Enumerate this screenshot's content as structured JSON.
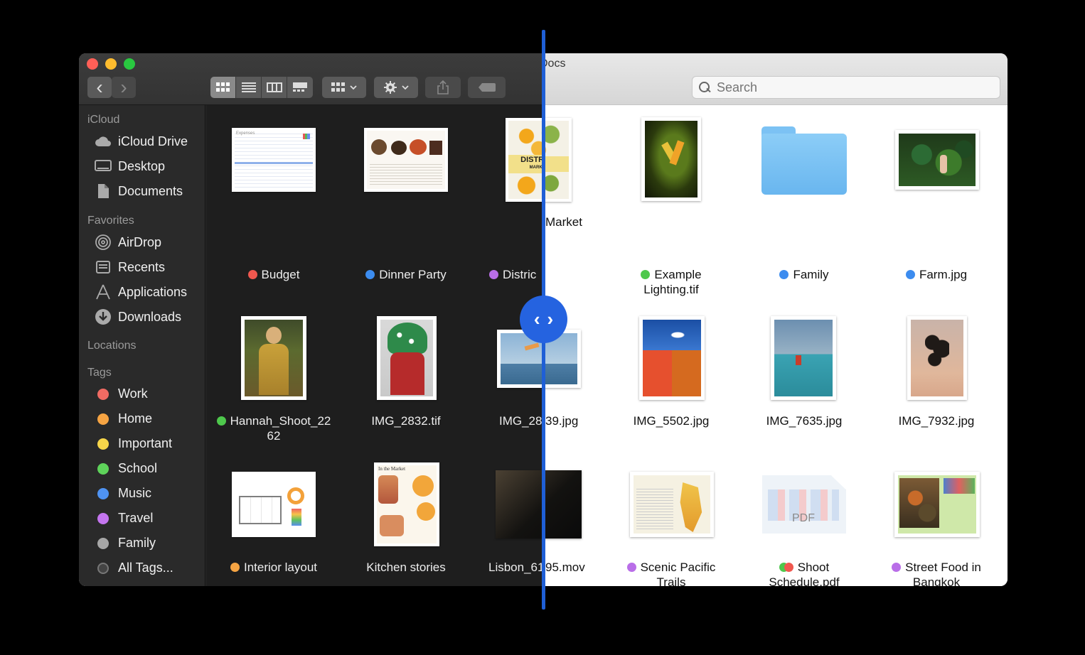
{
  "window": {
    "title": "Docs"
  },
  "search": {
    "placeholder": "Search"
  },
  "toolbar": {
    "back_icon": "‹",
    "forward_icon": "›"
  },
  "sidebar": {
    "icloud_header": "iCloud",
    "icloud_items": [
      {
        "label": "iCloud Drive",
        "icon": "cloud-icon"
      },
      {
        "label": "Desktop",
        "icon": "desktop-icon"
      },
      {
        "label": "Documents",
        "icon": "documents-icon"
      }
    ],
    "favorites_header": "Favorites",
    "favorites_items": [
      {
        "label": "AirDrop",
        "icon": "airdrop-icon"
      },
      {
        "label": "Recents",
        "icon": "recents-icon"
      },
      {
        "label": "Applications",
        "icon": "applications-icon"
      },
      {
        "label": "Downloads",
        "icon": "downloads-icon"
      }
    ],
    "locations_header": "Locations",
    "tags_header": "Tags",
    "tags": [
      {
        "label": "Work",
        "color": "#f06b63"
      },
      {
        "label": "Home",
        "color": "#f6a443"
      },
      {
        "label": "Important",
        "color": "#f7d64a"
      },
      {
        "label": "School",
        "color": "#5ed35a"
      },
      {
        "label": "Music",
        "color": "#4f93f2"
      },
      {
        "label": "Travel",
        "color": "#c475ef"
      },
      {
        "label": "Family",
        "color": "#a7a7a7"
      },
      {
        "label": "All Tags...",
        "color": "#555555"
      }
    ]
  },
  "files": [
    {
      "name": "Budget",
      "tag": "#f0584f"
    },
    {
      "name": "Dinner Party",
      "tag": "#3c8cef"
    },
    {
      "name_dark": "Distric",
      "name_light": "Market",
      "tag": "#b96ee8"
    },
    {
      "name_line1": "Example",
      "name_line2": "Lighting.tif",
      "tag": "#4ec84c"
    },
    {
      "name": "Family",
      "tag": "#3c8cef"
    },
    {
      "name": "Farm.jpg",
      "tag": "#3c8cef"
    },
    {
      "name_line1": "Hannah_Shoot_22",
      "name_line2": "62",
      "tag": "#4ec84c"
    },
    {
      "name": "IMG_2832.tif"
    },
    {
      "name_dark": "IMG_28",
      "name_light": "39.jpg"
    },
    {
      "name": "IMG_5502.jpg"
    },
    {
      "name": "IMG_7635.jpg"
    },
    {
      "name": "IMG_7932.jpg"
    },
    {
      "name": "Interior layout",
      "tag": "#f6a443"
    },
    {
      "name": "Kitchen stories"
    },
    {
      "name_dark": "Lisbon_61",
      "name_light": "95.mov"
    },
    {
      "name_line1": "Scenic Pacific",
      "name_line2": "Trails",
      "tag": "#b96ee8"
    },
    {
      "name_line1": "Shoot",
      "name_line2": "Schedule.pdf",
      "tag": "#4ec84c",
      "tag2": "#f0584f"
    },
    {
      "name_line1": "Street Food in",
      "name_line2": "Bangkok",
      "tag": "#b96ee8"
    }
  ],
  "thumbs": {
    "district_title": "DISTRICT",
    "district_sub": "MARKET",
    "pdf_badge": "PDF",
    "budget_header": "Expenses",
    "kitchen_header": "In the Market"
  },
  "divider": {
    "left_arrow": "‹",
    "right_arrow": "›"
  }
}
